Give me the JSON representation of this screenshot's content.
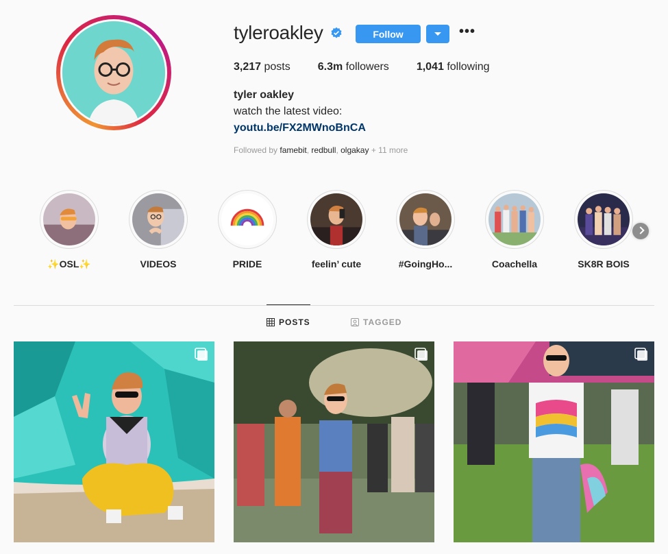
{
  "profile": {
    "username": "tyleroakley",
    "verified": true,
    "follow_label": "Follow",
    "more_label": "•••",
    "posts_count": "3,217",
    "posts_label": "posts",
    "followers_count": "6.3m",
    "followers_label": "followers",
    "following_count": "1,041",
    "following_label": "following",
    "full_name": "tyler oakley",
    "bio": "watch the latest video:",
    "link": "youtu.be/FX2MWnoBnCA",
    "followed_by_prefix": "Followed by",
    "followed_by_names": [
      "famebit",
      "redbull",
      "olgakay"
    ],
    "followed_by_more": "+ 11 more"
  },
  "highlights": [
    {
      "label": "✨OSL✨"
    },
    {
      "label": "VIDEOS"
    },
    {
      "label": "PRIDE"
    },
    {
      "label": "feelin’ cute"
    },
    {
      "label": "#GoingHo..."
    },
    {
      "label": "Coachella"
    },
    {
      "label": "SK8R BOIS"
    }
  ],
  "tabs": [
    {
      "label": "POSTS",
      "icon": "grid-icon",
      "active": true
    },
    {
      "label": "TAGGED",
      "icon": "tag-icon",
      "active": false
    }
  ],
  "posts": [
    {
      "type": "carousel"
    },
    {
      "type": "carousel"
    },
    {
      "type": "carousel"
    }
  ],
  "colors": {
    "accent": "#3897f0",
    "link": "#003569",
    "text": "#262626",
    "muted": "#999999",
    "background": "#fafafa"
  }
}
